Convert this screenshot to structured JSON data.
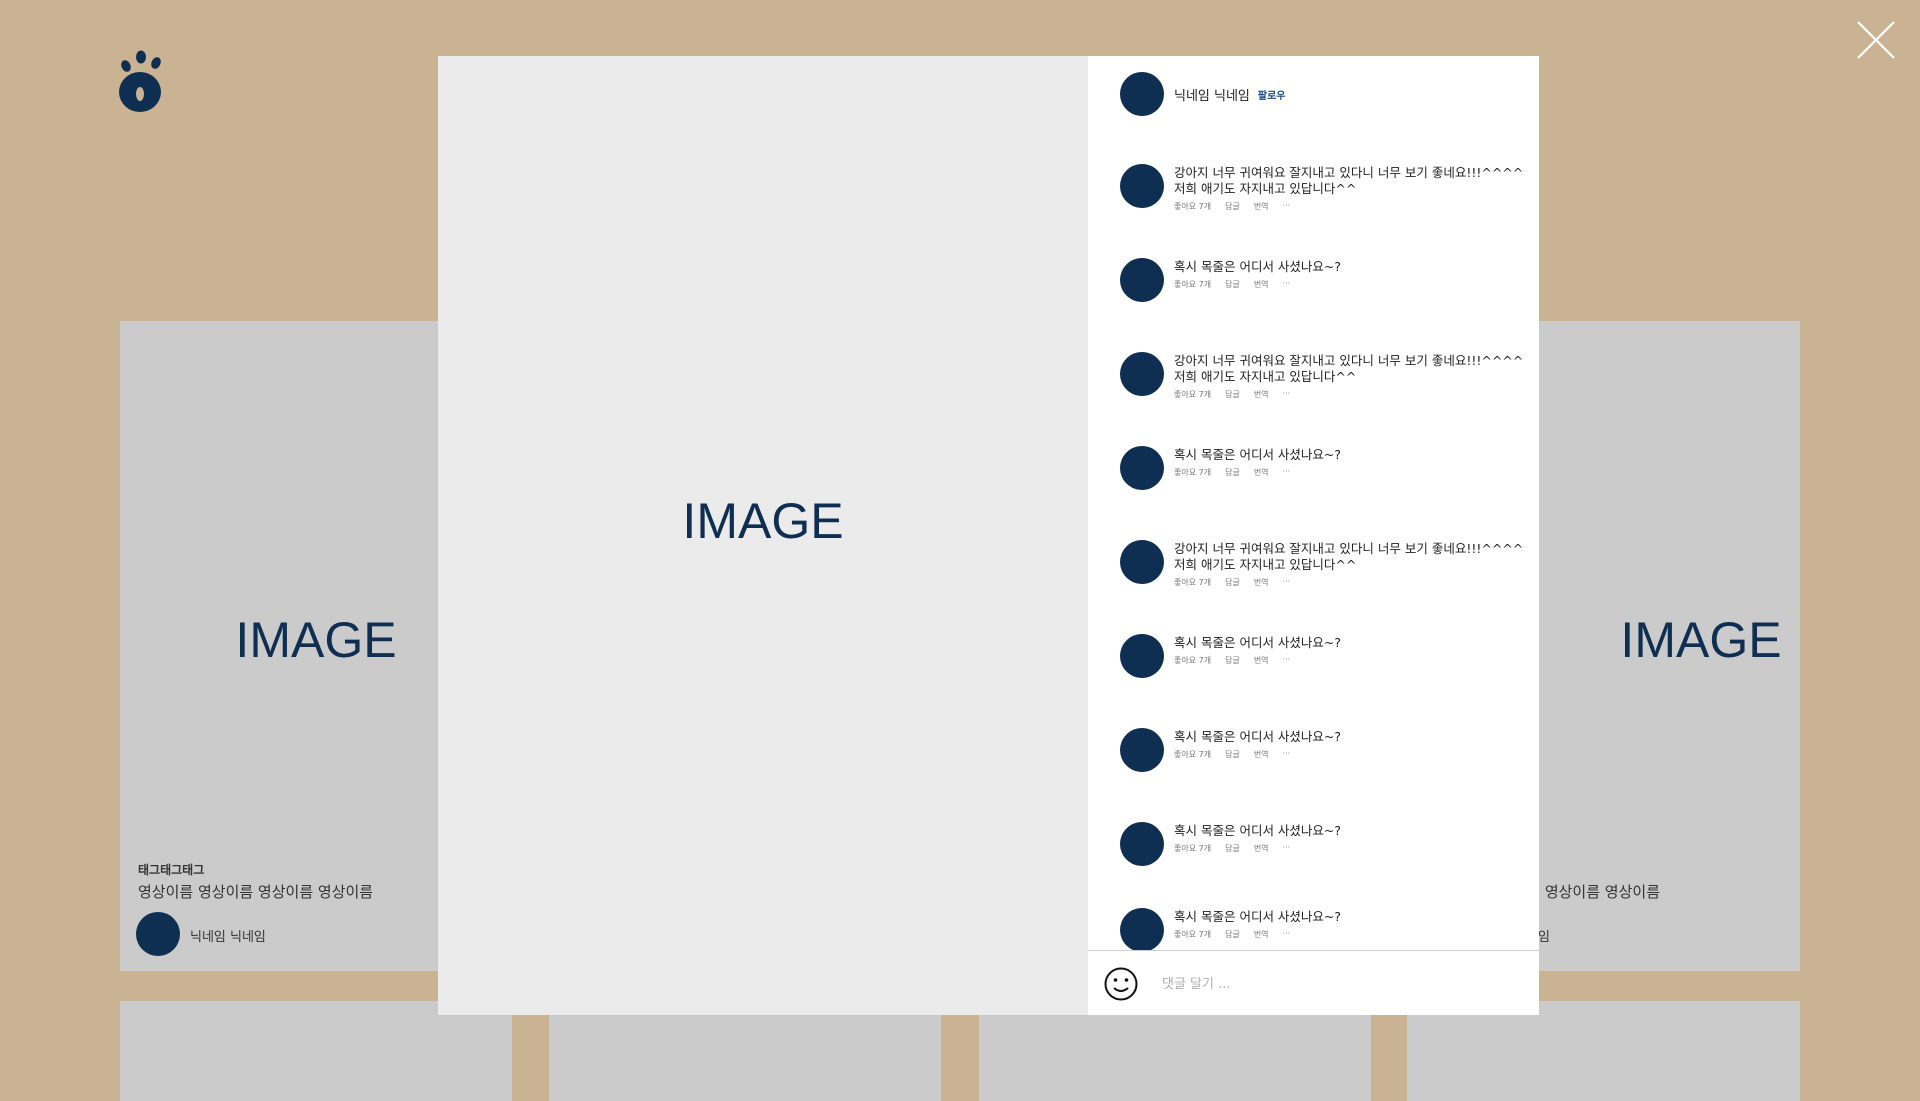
{
  "cards": [
    {
      "placeholder": "IMAGE",
      "tag": "태그태그태그",
      "title": "영상이름 영상이름 영상이름 영상이름",
      "nickname": "닉네임 닉네임"
    },
    {
      "placeholder": "IMAGE",
      "tag": "",
      "title": "영상이름 영상이름",
      "nickname": "임"
    }
  ],
  "modal": {
    "image_placeholder": "IMAGE",
    "author": {
      "nickname": "닉네임 닉네임",
      "follow": "팔로우"
    },
    "comments": [
      {
        "text": "강아지 너무 귀여워요 잘지내고 있다니 너무 보기 좋네요!!!^^^^\n저희 애기도 자지내고 있답니다^^",
        "likes": "좋아요 7개",
        "reply": "답글",
        "translate": "번역",
        "more": "···"
      },
      {
        "text": "혹시 목줄은 어디서 사셨나요~?",
        "likes": "좋아요 7개",
        "reply": "답글",
        "translate": "번역",
        "more": "···"
      },
      {
        "text": "강아지 너무 귀여워요 잘지내고 있다니 너무 보기 좋네요!!!^^^^\n저희 애기도 자지내고 있답니다^^",
        "likes": "좋아요 7개",
        "reply": "답글",
        "translate": "번역",
        "more": "···"
      },
      {
        "text": "혹시 목줄은 어디서 사셨나요~?",
        "likes": "좋아요 7개",
        "reply": "답글",
        "translate": "번역",
        "more": "···"
      },
      {
        "text": "강아지 너무 귀여워요 잘지내고 있다니 너무 보기 좋네요!!!^^^^\n저희 애기도 자지내고 있답니다^^",
        "likes": "좋아요 7개",
        "reply": "답글",
        "translate": "번역",
        "more": "···"
      },
      {
        "text": "혹시 목줄은 어디서 사셨나요~?",
        "likes": "좋아요 7개",
        "reply": "답글",
        "translate": "번역",
        "more": "···"
      },
      {
        "text": "혹시 목줄은 어디서 사셨나요~?",
        "likes": "좋아요 7개",
        "reply": "답글",
        "translate": "번역",
        "more": "···"
      },
      {
        "text": "혹시 목줄은 어디서 사셨나요~?",
        "likes": "좋아요 7개",
        "reply": "답글",
        "translate": "번역",
        "more": "···"
      },
      {
        "text": "혹시 목줄은 어디서 사셨나요~?",
        "likes": "좋아요 7개",
        "reply": "답글",
        "translate": "번역",
        "more": "···"
      }
    ],
    "input": {
      "placeholder": "댓글 달기 ..."
    }
  },
  "colors": {
    "background": "#c9b393",
    "accent": "#0f2f52",
    "card": "#cbcbcb"
  },
  "icons": [
    "paw-logo-icon",
    "close-icon",
    "smile-icon"
  ]
}
